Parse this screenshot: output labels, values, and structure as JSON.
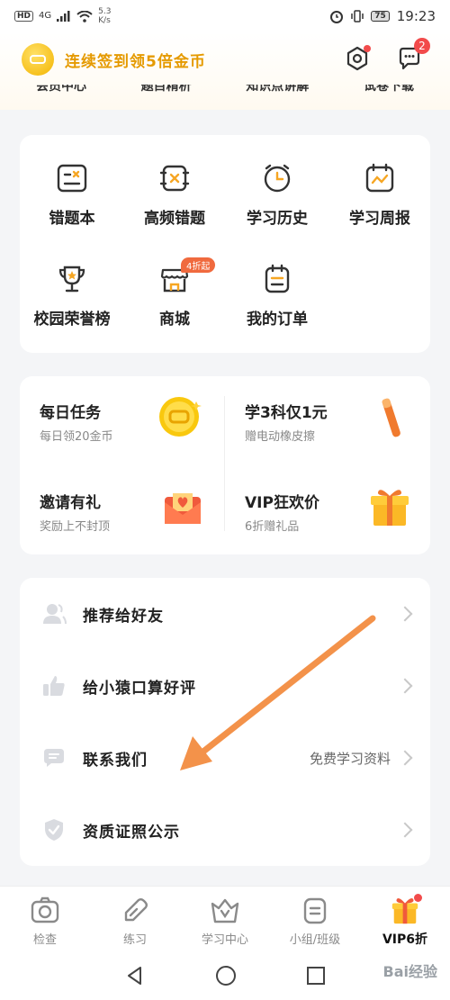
{
  "status_bar": {
    "hd": "HD",
    "network": "4G",
    "speed": "5.3",
    "speed_unit": "K/s",
    "battery": "75",
    "time": "19:23"
  },
  "header": {
    "title": "连续签到领5倍金币",
    "message_count": "2",
    "quick_links": [
      "会员中心",
      "题目精析",
      "知识点讲解",
      "试卷下载"
    ]
  },
  "tools": [
    {
      "label": "错题本",
      "icon": "wrong-book-icon"
    },
    {
      "label": "高频错题",
      "icon": "frequent-errors-icon"
    },
    {
      "label": "学习历史",
      "icon": "clock-icon"
    },
    {
      "label": "学习周报",
      "icon": "calendar-chart-icon"
    },
    {
      "label": "校园荣誉榜",
      "icon": "trophy-icon"
    },
    {
      "label": "商城",
      "icon": "shop-icon",
      "badge": "4折起"
    },
    {
      "label": "我的订单",
      "icon": "order-list-icon"
    }
  ],
  "promos": [
    {
      "title": "每日任务",
      "subtitle": "每日领20金币",
      "icon": "gold-coin-icon"
    },
    {
      "title": "学3科仅1元",
      "subtitle": "赠电动橡皮擦",
      "icon": "eraser-icon"
    },
    {
      "title": "邀请有礼",
      "subtitle": "奖励上不封顶",
      "icon": "envelope-heart-icon"
    },
    {
      "title": "VIP狂欢价",
      "subtitle": "6折赠礼品",
      "icon": "gift-box-icon"
    }
  ],
  "menu": [
    {
      "label": "推荐给好友",
      "icon": "people-icon",
      "extra": ""
    },
    {
      "label": "给小猿口算好评",
      "icon": "thumbs-up-icon",
      "extra": ""
    },
    {
      "label": "联系我们",
      "icon": "chat-bubble-icon",
      "extra": "免费学习资料"
    },
    {
      "label": "资质证照公示",
      "icon": "shield-check-icon",
      "extra": ""
    }
  ],
  "tabs": [
    {
      "label": "检查",
      "icon": "camera-icon"
    },
    {
      "label": "练习",
      "icon": "pencil-tag-icon"
    },
    {
      "label": "学习中心",
      "icon": "crown-v-icon"
    },
    {
      "label": "小组/班级",
      "icon": "group-list-icon"
    },
    {
      "label": "VIP6折",
      "icon": "gift-icon",
      "active": true
    }
  ],
  "watermark": "Bai经验",
  "colors": {
    "accent_orange": "#e59a00",
    "badge_red": "#f24b4b",
    "arrow_orange": "#f3924a",
    "background": "#f4f5f7"
  }
}
